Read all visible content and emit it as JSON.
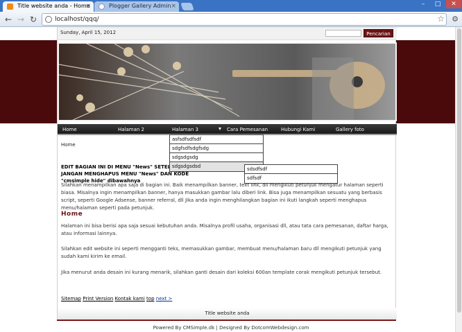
{
  "browser": {
    "tabs": [
      {
        "title": "Title website anda - Home"
      },
      {
        "title": "Plogger Gallery Admin"
      }
    ],
    "url": "localhost/qqq/",
    "window_controls": [
      "–",
      "□",
      "✕"
    ]
  },
  "topbar": {
    "date": "Sunday, April 15, 2012",
    "search_placeholder": "",
    "search_button": "Pencarian"
  },
  "menu": {
    "items": [
      "Home",
      "Halaman 2",
      "Halaman 3",
      "Cara Pemesanan",
      "Hubungi Kami",
      "Gallery foto"
    ],
    "dropdown": [
      "asfsdfsdfsdf",
      "sdgfsdfsdgfsdg",
      "sdgsdgsdg",
      "sdgsdgsdsd"
    ],
    "subdropdown": [
      "sdsdfsdf",
      "sdfsdf"
    ]
  },
  "content": {
    "breadcrumb": "Home",
    "edit_note_1": "EDIT BAGIAN INI DI MENU \"News\" SETELAH",
    "edit_note_2": "JANGAN MENGHAPUS MENU \"News\" DAN KODE",
    "edit_note_tail": "\"cmsimple hide\" dibawahnya",
    "intro": "Silahkan menampilkan apa saja di bagian ini. Baik menampilkan banner, text link, dll mengikuti petunjuk mengatur halaman seperti biasa. Misalnya ingin menampilkan banner, hanya masukkan gambar lalu diberi link. Bisa juga menampilkan sesuatu yang berbasis script, seperti Google Adsense, banner referral, dll Jika anda ingin menghilangkan bagian ini ikuti langkah seperti menghapus menu/halaman seperti pada petunjuk.",
    "heading": "Home",
    "p1": "Halaman ini bisa berisi apa saja sesuai kebutuhan anda. Misalnya profil usaha, organisasi dll, atau tata cara pemesanan, daftar harga, atau informasi lainnya.",
    "p2": "Silahkan edit website ini seperti mengganti teks, memasukkan gambar, membuat menu/halaman baru dll mengikuti petunjuk yang sudah kami kirim ke email.",
    "p3": "Jika menurut anda desain ini kurang menarik, silahkan ganti desain dari koleksi 600an template corak mengikuti petunjuk tersebut."
  },
  "footer": {
    "links": [
      "Sitemap",
      "Print Version",
      "Kontak kami",
      "top",
      "next >"
    ],
    "site_title": "Title website anda",
    "powered": "Powered By CMSimple.dk | Designed By DotcomWebdesign.com"
  }
}
